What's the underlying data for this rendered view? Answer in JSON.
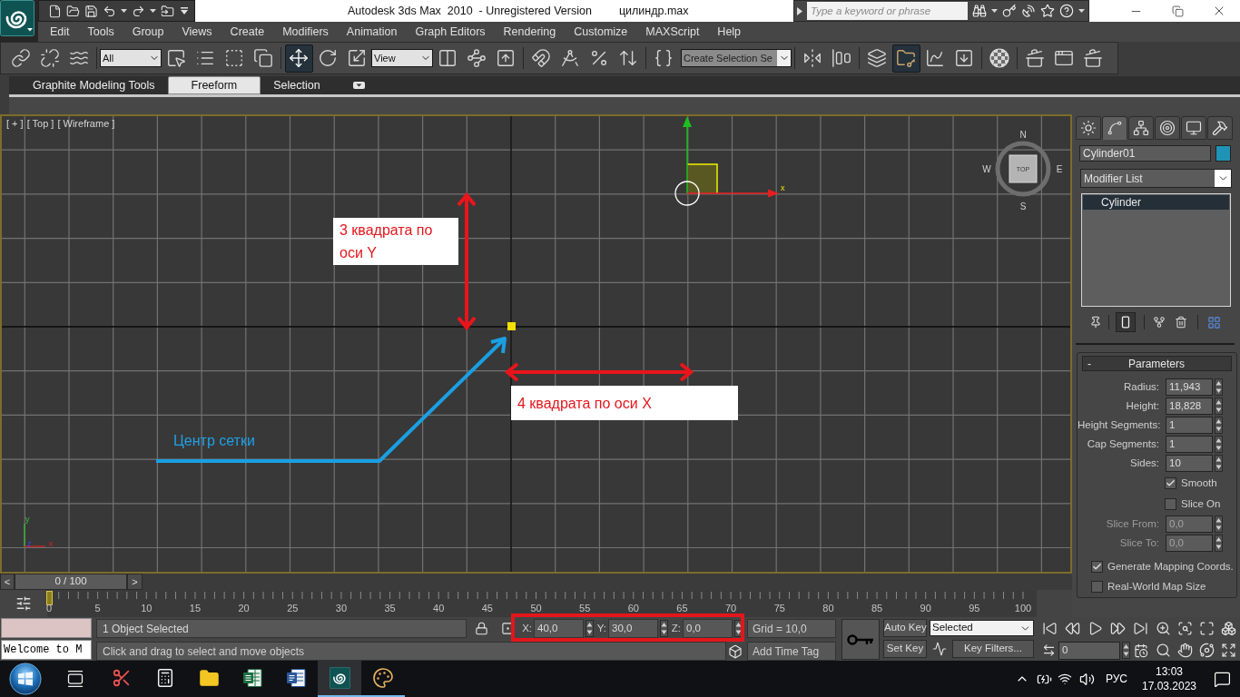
{
  "window": {
    "title": "Autodesk 3ds Max  2010  - Unregistered Version",
    "file": "цилиндр.max"
  },
  "search": {
    "placeholder": "Type a keyword or phrase"
  },
  "menu": [
    "Edit",
    "Tools",
    "Group",
    "Views",
    "Create",
    "Modifiers",
    "Animation",
    "Graph Editors",
    "Rendering",
    "Customize",
    "MAXScript",
    "Help"
  ],
  "toolbar": {
    "selection_filter": "All",
    "reference_coordinate_system": "View",
    "named_selection_set": "Create Selection Se",
    "move_tool_on": true,
    "ribbon_toggle_on": true
  },
  "ribbon_tabs": [
    {
      "label": "Graphite Modeling Tools",
      "selected": false
    },
    {
      "label": "Freeform",
      "selected": true
    },
    {
      "label": "Selection",
      "selected": false
    }
  ],
  "viewport": {
    "labels": [
      "[ + ]",
      "[ Top ]",
      "[ Wireframe ]"
    ],
    "viewcube": {
      "face": "TOP",
      "compass": [
        "N",
        "W",
        "E",
        "S"
      ]
    },
    "gizmo_axis": "x",
    "tripod": [
      "y",
      "z",
      "x"
    ]
  },
  "annotations": [
    {
      "kind": "box",
      "text": "3 квадрата по оси Y"
    },
    {
      "kind": "box",
      "text": "4 квадрата по оси X"
    },
    {
      "kind": "plain",
      "text": "Центр сетки"
    }
  ],
  "command_panel": {
    "tabs": [
      {
        "selected": false
      },
      {
        "selected": true
      },
      {
        "selected": false
      },
      {
        "selected": false
      },
      {
        "selected": false
      },
      {
        "selected": false
      }
    ],
    "object": {
      "name": "Cylinder01",
      "color": "#1f93b6"
    },
    "modifier_list": "Modifier List",
    "stack": [
      {
        "label": "Cylinder",
        "selected": true
      }
    ],
    "end_result_on": true,
    "rollout": {
      "toggle": "-",
      "title": "Parameters",
      "parameters": [
        {
          "kind": "spinner",
          "label": "Radius:",
          "value": "11,943",
          "disabled": false
        },
        {
          "kind": "spinner",
          "label": "Height:",
          "value": "18,828",
          "disabled": false
        },
        {
          "kind": "spinner",
          "label": "Height Segments:",
          "value": "1",
          "disabled": false
        },
        {
          "kind": "spinner",
          "label": "Cap Segments:",
          "value": "1",
          "disabled": false
        },
        {
          "kind": "spinner",
          "label": "Sides:",
          "value": "10",
          "disabled": false
        },
        {
          "kind": "checkbox",
          "label": "Smooth",
          "checked": true,
          "disabled": false
        },
        {
          "kind": "checkbox",
          "label": "Slice On",
          "checked": false,
          "disabled": false
        },
        {
          "kind": "spinner",
          "label": "Slice From:",
          "value": "0,0",
          "disabled": true
        },
        {
          "kind": "spinner",
          "label": "Slice To:",
          "value": "0,0",
          "disabled": true
        }
      ],
      "options": [
        {
          "label": "Generate Mapping Coords.",
          "checked": true
        },
        {
          "label": "Real-World Map Size",
          "checked": false
        }
      ]
    }
  },
  "time_slider": {
    "previous": "<",
    "position": "0 / 100",
    "next": ">",
    "level": 0
  },
  "track_bar": {
    "ticks": [
      "0",
      "5",
      "10",
      "15",
      "20",
      "25",
      "30",
      "35",
      "40",
      "45",
      "50",
      "55",
      "60",
      "65",
      "70",
      "75",
      "80",
      "85",
      "90",
      "95",
      "100"
    ]
  },
  "status": {
    "listener": "Welcome to M",
    "selection": "1 Object Selected",
    "prompt": "Click and drag to select and move objects",
    "coords": [
      {
        "axis": "X:",
        "value": "40,0"
      },
      {
        "axis": "Y:",
        "value": "30,0"
      },
      {
        "axis": "Z:",
        "value": "0,0"
      }
    ],
    "coords_highlighted": true,
    "grid": "Grid = 10,0",
    "time_tag": "Add Time Tag"
  },
  "animation": {
    "auto_key": "Auto Key",
    "set_key": "Set Key",
    "key_set": "Selected",
    "key_filters": "Key Filters...",
    "frame": "0"
  },
  "taskbar": {
    "apps": [
      {
        "selected": false,
        "running": false
      },
      {
        "selected": false,
        "running": false
      },
      {
        "selected": false,
        "running": false
      },
      {
        "selected": false,
        "running": false
      },
      {
        "selected": false,
        "running": false
      },
      {
        "selected": true,
        "running": true
      },
      {
        "selected": false,
        "running": true
      }
    ],
    "language": "РУС",
    "time": "13:03",
    "date": "17.03.2023"
  }
}
